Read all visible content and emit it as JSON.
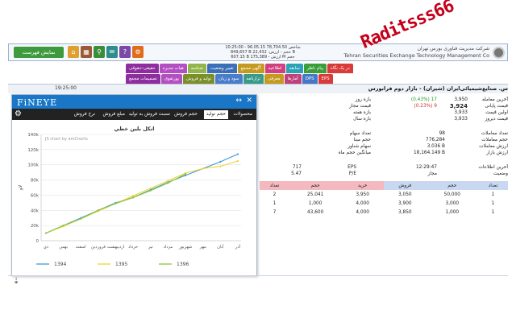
{
  "header": {
    "menu_button": "نمایش فهرست",
    "tool_icons": [
      {
        "icon": "home-icon",
        "color": "#e0a030",
        "glyph": "⌂"
      },
      {
        "icon": "grid-icon",
        "color": "#9b5a35",
        "glyph": "▦"
      },
      {
        "icon": "search-icon",
        "color": "#3a8e3a",
        "glyph": "⚲"
      },
      {
        "icon": "chat-icon",
        "color": "#2e8d8d",
        "glyph": "✉"
      },
      {
        "icon": "help-icon",
        "color": "#7b4aa8",
        "glyph": "?"
      },
      {
        "icon": "settings-icon",
        "color": "#e06d1c",
        "glyph": "⚙"
      }
    ],
    "clock_lines": [
      "10:25:00 - 96.05.15 شاخص 78,704.50",
      "849,657 B حجم - ارزش: 22,432 B",
      "607.15 B ارزش - 175,389 M حجم"
    ],
    "company_fa": "شرکت مدیریت فناوری بورس تهران",
    "company_en": "Tehran Securities Exchange Technology Management Co",
    "watermark": "Raditsss66"
  },
  "tabs_row1": [
    {
      "label": "حقیقی-حقوقی",
      "color": "#8e2e9e"
    },
    {
      "label": "هیات مدیره",
      "color": "#b34fc0"
    },
    {
      "label": "شناسه",
      "color": "#91b54a"
    },
    {
      "label": "تغییر وضعیت",
      "color": "#3b6fb8"
    },
    {
      "label": "آگهی مجمع",
      "color": "#c59a20"
    },
    {
      "label": "اطلاعیه",
      "color": "#d04080"
    },
    {
      "label": "سابقه",
      "color": "#2aa3b5"
    },
    {
      "label": "پیام ناظر",
      "color": "#3a9e3a"
    },
    {
      "label": "در یک نگاه",
      "color": "#d93a3a"
    }
  ],
  "tabs_row2": [
    {
      "label": "تصمیمات مجمع",
      "color": "#8e2e9e"
    },
    {
      "label": "پورتفوی",
      "color": "#b34fc0"
    },
    {
      "label": "تولید و فروش",
      "color": "#7a8e2a"
    },
    {
      "label": "سود و زیان",
      "color": "#4a7cc9"
    },
    {
      "label": "ترازنامه",
      "color": "#3a9a8a"
    },
    {
      "label": "معرفی",
      "color": "#c59a20"
    },
    {
      "label": "آمارها",
      "color": "#c0407a"
    },
    {
      "label": "DPS",
      "color": "#4478c6"
    },
    {
      "label": "EPS",
      "color": "#d93a3a"
    }
  ],
  "main": {
    "time": "19:25:00",
    "title": "س. صنایع‌شیمیائی‌ایران (شیران) - بازار دوم فرابورس"
  },
  "stats_left": {
    "labels": [
      "آخرین معامله",
      "قیمت پایانی",
      "اولین قیمت",
      "قیمت دیروز"
    ],
    "values": [
      "3,950",
      "3,924",
      "3,933",
      "3,933"
    ],
    "changes": [
      "(0.43%) 17",
      "(0.23%) 9"
    ]
  },
  "stats_right": {
    "labels": [
      "بازه روز",
      "قیمت مجاز",
      "بازه هفته",
      "بازه سال"
    ],
    "values": [
      "",
      "",
      "",
      ""
    ]
  },
  "stats_mid": {
    "labels": [
      "تعداد معاملات",
      "حجم معاملات",
      "ارزش معاملات",
      "ارزش بازار"
    ],
    "values": [
      "98",
      "776,284",
      "3.036 B",
      "18,164.149 B"
    ],
    "side_labels": [
      "تعداد سهام",
      "حجم مبنا",
      "سهام شناور",
      "میانگین حجم ماه"
    ]
  },
  "stats_low": {
    "left_labels": [
      "آخرین اطلاعات",
      "وضعیت"
    ],
    "right_labels": [
      "EPS",
      "P/E"
    ],
    "right_values": [
      "717",
      "5.47"
    ],
    "time": "12:29:47",
    "status": "مجاز"
  },
  "orderbook": {
    "headers": [
      "تعداد",
      "حجم",
      "فروش",
      "خرید",
      "حجم",
      "تعداد"
    ],
    "rows": [
      [
        "1",
        "50,000",
        "3,050",
        "3,950",
        "25,041",
        "2"
      ],
      [
        "1",
        "3,000",
        "3,900",
        "4,000",
        "1,000",
        "1"
      ],
      [
        "1",
        "1,000",
        "3,850",
        "4,000",
        "43,600",
        "7"
      ]
    ]
  },
  "fineye": {
    "logo": "FiNEYE",
    "tabs": [
      "محصولات",
      "حجم تولید",
      "حجم فروش",
      "نسبت فروش به تولید",
      "مبلغ فروش",
      "نرخ فروش"
    ],
    "active_tab": "حجم تولید",
    "chart_title": "انکل بلین خطي",
    "credit": "JS chart by amCharts"
  },
  "chart_data": {
    "type": "line",
    "title": "انکل بلین خطي",
    "ylabel": "لاو",
    "ylim": [
      0,
      140000
    ],
    "yticks": [
      "0",
      "20k",
      "40k",
      "60k",
      "80k",
      "100k",
      "120k",
      "140k"
    ],
    "categories": [
      "دي",
      "بهمن",
      "اسفند",
      "فروردین",
      "اردیبهشت",
      "خرداد",
      "تیر",
      "مرداد",
      "شهریور",
      "مهر",
      "آبان",
      "آذر"
    ],
    "series": [
      {
        "name": "1394",
        "color": "#3b9ad9",
        "values": [
          10000,
          20000,
          30000,
          40000,
          50000,
          57000,
          67000,
          77000,
          86000,
          95000,
          104000,
          114000
        ]
      },
      {
        "name": "1395",
        "color": "#f2d22e",
        "values": [
          10000,
          19000,
          29000,
          39000,
          49000,
          59000,
          69000,
          79000,
          89000,
          95000,
          98000,
          105000
        ]
      },
      {
        "name": "1396",
        "color": "#8cc63f",
        "values": [
          10000,
          20000,
          29000,
          40000,
          49000,
          57000,
          66000,
          76000,
          88000,
          null,
          null,
          null
        ]
      }
    ],
    "legend_position": "bottom",
    "grid": true
  }
}
